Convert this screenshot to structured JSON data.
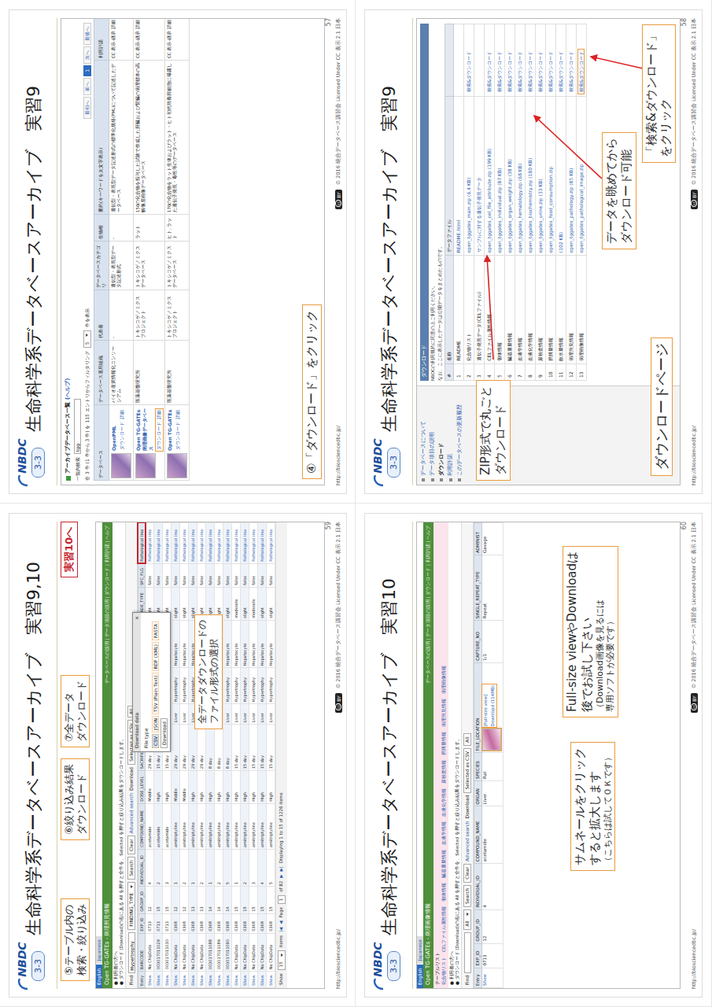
{
  "slides": [
    {
      "kind": "dblist",
      "logo": "NBDC",
      "badge": "3-3",
      "title": "生命科学系データベースアーカイブ　実習9",
      "page": "57",
      "url": "http://biosciencedbc.jp/",
      "cc": [
        "cc",
        "BY"
      ],
      "copyright": "© 2016  統合データベース講習会 Licensed Under CC 表示 2.1 日本",
      "screen": {
        "heading": "アーカイブデータベース一覧",
        "help": "(ヘルプ)",
        "search_label": "一覧内検索",
        "search_value": "tgg",
        "info": "全 3 件 (1 件から 3 件) を 115 エントリからフィルタリング",
        "per_page": "5",
        "per_page_label": "件を表示",
        "pager": [
          {
            "label": "最初へ",
            "selected": false
          },
          {
            "label": "前へ",
            "selected": false
          },
          {
            "label": "1",
            "selected": true
          },
          {
            "label": "次へ",
            "selected": false
          },
          {
            "label": "最後へ",
            "selected": false
          }
        ],
        "columns": [
          "データベース",
          "データベース運用組織",
          "代表者",
          "データベースカテゴリ",
          "生物種",
          "要約(キーワードを太文字表示)",
          "利用許諾"
        ],
        "rows": [
          {
            "name": "OpenPML",
            "links": [
              "ダウンロード",
              "詳細"
            ],
            "highlighted": false,
            "cells": [
              "バイオ産業情報化コンソーシアム",
              "-",
              "遺伝型・表現型データ記述形式",
              "-",
              "遺伝型・表現型データ記述形式の標準化規格(PML)について記述したデータベース",
              "CC 表示-継承 詳細"
            ]
          },
          {
            "name": "Open TG-GATEs 病理画像データベース",
            "links": [
              "ダウンロード",
              "詳細"
            ],
            "highlighted": true,
            "cells": [
              "医薬基盤研究所",
              "トキシコゲノミクスプロジェクト",
              "トキシコゲノミクスデータベース",
              "ラット",
              "150の化合物を投与した試験で作成した肝臓および腎臓の病理標本の高解像度画像データベース",
              "CC 表示-継承 詳細"
            ]
          },
          {
            "name": "Open TG-GATEs",
            "links": [
              "ダウンロード",
              "詳細"
            ],
            "highlighted": false,
            "cells": [
              "医薬基盤研究所",
              "トキシコゲノミクスプロジェクト",
              "トキシコゲノミクスデータベース",
              "ヒト, ラット",
              "170の化合物をラット生体およびラット・ヒト初代培養肝細胞に曝露した遺伝子発現・毒性等のデータベース",
              "CC 表示-継承 詳細"
            ]
          }
        ]
      },
      "callouts": [
        {
          "lines": [
            "④「ダウンロード」をクリック"
          ]
        }
      ]
    },
    {
      "kind": "download",
      "logo": "NBDC",
      "badge": "3-3",
      "title": "生命科学系データベースアーカイブ　実習9",
      "page": "58",
      "url": "http://biosciencedbc.jp/",
      "cc": [
        "cc",
        "BY"
      ],
      "copyright": "© 2016  統合データベース講習会 Licensed Under CC 表示 2.1 日本",
      "screen": {
        "sidebar": [
          {
            "label": "データベースについて",
            "selected": false
          },
          {
            "label": "データ項目の説明",
            "selected": false
          },
          {
            "label": "ダウンロード",
            "selected": true
          },
          {
            "label": "利用許諾",
            "selected": false
          },
          {
            "label": "このデータベースの更新履歴",
            "selected": false
          }
        ],
        "heading": "ダウンロード",
        "notes": [
          "NBDCの利用規約に同意の上ご利用ください。",
          "なお、ここに表示したデータは公開データをまとめたものです。"
        ],
        "columns": [
          "#",
          "名称",
          "データファイル",
          ""
        ],
        "rows": [
          {
            "no": "1",
            "name": "README",
            "file": "README.html",
            "action": "",
            "highlighted": false
          },
          {
            "no": "2",
            "name": "化合物リスト",
            "file": "open_tggates_main.zip (6.4 KB)",
            "action": "検索&ダウンロード",
            "highlighted": false
          },
          {
            "no": "3",
            "name": "遺伝子発現データ(CELファイル)",
            "file": "サンプルに対する遺伝子発現データ",
            "action": "",
            "highlighted": false
          },
          {
            "no": "4",
            "name": "CELファイル属性情報",
            "file": "open_tggates_cel_file_attribute.zip (199 KB)",
            "action": "検索&ダウンロード",
            "highlighted": false
          },
          {
            "no": "5",
            "name": "個体情報",
            "file": "open_tggates_individual.zip (87 KB)",
            "action": "検索&ダウンロード",
            "highlighted": false
          },
          {
            "no": "6",
            "name": "臓器重量情報",
            "file": "open_tggates_organ_weight.zip (38 KB)",
            "action": "検索&ダウンロード",
            "highlighted": false
          },
          {
            "no": "7",
            "name": "血液学情報",
            "file": "open_tggates_hematology.zip (68 KB)",
            "action": "検索&ダウンロード",
            "highlighted": false
          },
          {
            "no": "8",
            "name": "血液化学情報",
            "file": "open_tggates_biochemistry.zip (180 KB)",
            "action": "検索&ダウンロード",
            "highlighted": false
          },
          {
            "no": "9",
            "name": "尿検査情報",
            "file": "open_tggates_urine.zip (33 KB)",
            "action": "検索&ダウンロード",
            "highlighted": false
          },
          {
            "no": "10",
            "name": "摂餌量情報",
            "file": "open_tggates_food_consumption.zip",
            "action": "検索&ダウンロード",
            "highlighted": false
          },
          {
            "no": "11",
            "name": "飲水量情報",
            "file": "(102 KB)",
            "action": "検索&ダウンロード",
            "highlighted": false
          },
          {
            "no": "12",
            "name": "病理所見情報",
            "file": "open_tggates_pathology.zip (85 KB)",
            "action": "検索&ダウンロード",
            "highlighted": false
          },
          {
            "no": "13",
            "name": "病理画像情報",
            "file": "open_tggates_pathological_image.zip",
            "action": "検索&ダウンロード",
            "highlighted": true
          }
        ]
      },
      "callouts": [
        {
          "lines": [
            "ZIP形式で丸ごと",
            "ダウンロード"
          ]
        },
        {
          "lines": [
            "データを眺めてから",
            "ダウンロード可能"
          ]
        },
        {
          "lines": [
            "「検索&ダウンロード」",
            "をクリック"
          ]
        },
        {
          "lines": [
            "ダウンロードページ"
          ]
        }
      ]
    },
    {
      "kind": "table",
      "logo": "NBDC",
      "badge": "3-3",
      "title": "生命科学系データベースアーカイブ　実習9,10",
      "page": "59",
      "url": "http://biosciencedbc.jp/",
      "cc": [
        "cc",
        "BY"
      ],
      "copyright": "© 2016  統合データベース講習会 Licensed Under CC 表示 2.1 日本",
      "screen": {
        "lang": [
          {
            "label": "English",
            "selected": true
          },
          {
            "label": "Japanese",
            "selected": false
          }
        ],
        "brand": "Open TG-GATEs - 病理所見情報",
        "nav": "データベースの説明 | データ項目の説明 | ダウンロード | 利用許諾 | ヘルプ",
        "notes": [
          "● 利用者の方へ",
          "● ダウンロード (Download)の右にある All を押すと全件を、Selected を押すと絞り込み結果をダウンロードします。"
        ],
        "toolbar": {
          "find": "Find",
          "value": "Hypertrophy",
          "field": "FINDING_TYPE",
          "buttons": [
            "Search",
            "Clear"
          ],
          "advanced": "Advanced search",
          "download": "Download",
          "selected_as": "Selected as CSV",
          "all": "All"
        },
        "columns": [
          {
            "label": "Entry",
            "highlighted": false
          },
          {
            "label": "BARCODE",
            "highlighted": false
          },
          {
            "label": "EXP_ID",
            "highlighted": false
          },
          {
            "label": "GROUP_ID",
            "highlighted": false
          },
          {
            "label": "INDIVIDUAL_ID",
            "highlighted": false
          },
          {
            "label": "COMPOUND_NAME",
            "highlighted": false
          },
          {
            "label": "DOSE_LEVEL",
            "highlighted": false
          },
          {
            "label": "SACRIFICE_PERIOD",
            "highlighted": false
          },
          {
            "label": "ORGAN",
            "highlighted": false
          },
          {
            "label": "FINDING_TYPE",
            "highlighted": false
          },
          {
            "label": "TOPOGRAPHY_TYPE",
            "highlighted": false
          },
          {
            "label": "GRADE_TYPE",
            "highlighted": false
          },
          {
            "label": "SPC_FLG",
            "highlighted": false
          },
          {
            "label": "Pathological ima",
            "highlighted": true
          }
        ],
        "rows": [
          [
            "Show",
            "No ChipData",
            "0713",
            "12",
            "4",
            "acetamide",
            "Middle",
            "29 day",
            "Liver",
            "Hypertrophy",
            "Hepatocyte",
            "slight",
            "false",
            "Pathological ima"
          ],
          [
            "Show",
            "003017011029",
            "0713",
            "15",
            "2",
            "acetamide",
            "High",
            "15 day",
            "Liver",
            "Hypertrophy",
            "Hepatocyte",
            "slight",
            "false",
            "Pathological ima"
          ],
          [
            "Show",
            "003017011030",
            "0713",
            "15",
            "3",
            "acetamide",
            "High",
            "15 day",
            "Liver",
            "Hypertrophy",
            "Hepatocyte",
            "slight",
            "false",
            "Pathological ima"
          ],
          [
            "Show",
            "No ChipData",
            "0368",
            "12",
            "1",
            "amitriptyline",
            "Middle",
            "29 day",
            "Liver",
            "Hypertrophy",
            "Hepatocyte",
            "slight",
            "false",
            "Pathological ima"
          ],
          [
            "Show",
            "No ChipData",
            "0368",
            "12",
            "2",
            "amitriptyline",
            "Middle",
            "29 day",
            "Liver",
            "Hypertrophy",
            "Hepatocyte",
            "slight",
            "false",
            "Pathological ima"
          ],
          [
            "Show",
            "No ChipData",
            "0368",
            "13",
            "1",
            "amitriptyline",
            "High",
            "29 day",
            "Liver",
            "Hypertrophy",
            "Hepatocyte",
            "slight",
            "false",
            "Pathological ima"
          ],
          [
            "Show",
            "No ChipData",
            "0368",
            "13",
            "2",
            "amitriptyline",
            "High",
            "29 day",
            "Liver",
            "Hypertrophy",
            "Hepatocyte",
            "slight",
            "false",
            "Pathological ima"
          ],
          [
            "Show",
            "003017011088",
            "0368",
            "14",
            "1",
            "amitriptyline",
            "High",
            "8 day",
            "Liver",
            "Hypertrophy",
            "Hepatocyte",
            "slight",
            "false",
            "Pathological ima"
          ],
          [
            "Show",
            "003017011089",
            "0368",
            "14",
            "2",
            "amitriptyline",
            "High",
            "8 day",
            "Liver",
            "Hypertrophy",
            "Hepatocyte",
            "slight",
            "false",
            "Pathological ima"
          ],
          [
            "Show",
            "003017011090",
            "0368",
            "14",
            "5",
            "amitriptyline",
            "High",
            "8 day",
            "Liver",
            "Hypertrophy",
            "Hepatocyte",
            "slight",
            "false",
            "Pathological ima"
          ],
          [
            "Show",
            "No ChipData",
            "0368",
            "15",
            "1",
            "amitriptyline",
            "High",
            "15 day",
            "Liver",
            "Hypertrophy",
            "Hepatocyte",
            "moderate",
            "false",
            "Pathological ima"
          ],
          [
            "Show",
            "No ChipData",
            "0368",
            "15",
            "2",
            "amitriptyline",
            "High",
            "15 day",
            "Liver",
            "Hypertrophy",
            "Hepatocyte",
            "slight",
            "false",
            "Pathological ima"
          ],
          [
            "Show",
            "No ChipData",
            "0368",
            "15",
            "3",
            "amitriptyline",
            "High",
            "15 day",
            "Liver",
            "Hypertrophy",
            "Hepatocyte",
            "moderate",
            "false",
            "Pathological ima"
          ],
          [
            "Show",
            "No ChipData",
            "0368",
            "15",
            "4",
            "amitriptyline",
            "High",
            "15 day",
            "Liver",
            "Hypertrophy",
            "Hepatocyte",
            "slight",
            "false",
            "Pathological ima"
          ],
          [
            "Show",
            "No ChipData",
            "0368",
            "15",
            "5",
            "amitriptyline",
            "High",
            "15 day",
            "Liver",
            "Hypertrophy",
            "Hepatocyte",
            "slight",
            "false",
            "Pathological ima"
          ]
        ],
        "pager": {
          "show": "Show",
          "per_page": "15",
          "items": "items",
          "first": "|◀",
          "prev": "◀",
          "page_label": "Page",
          "page": "1",
          "of": "of 82",
          "next": "▶",
          "last": "▶|",
          "display": "Displaying 1 to 15 of 1226 items"
        },
        "popup": {
          "title": "Download data",
          "close": "×",
          "label": "File type",
          "options": [
            {
              "label": "CSV",
              "selected": true
            },
            {
              "label": "JSON",
              "selected": false
            },
            {
              "label": "TSV (Plain Text)",
              "selected": false
            },
            {
              "label": "RDF (XML)",
              "selected": false
            },
            {
              "label": "FASTA",
              "selected": false
            }
          ],
          "button": "Download"
        }
      },
      "callouts": [
        {
          "lines": [
            "⑤テーブル内の",
            "検索・絞り込み"
          ]
        },
        {
          "lines": [
            "⑥絞り込み結果",
            "ダウンロード"
          ]
        },
        {
          "lines": [
            "⑦全データ",
            "ダウンロード"
          ]
        },
        {
          "lines": [
            "全データダウンロードの",
            "ファイル形式の選択"
          ]
        },
        {
          "lines": [
            "実習10へ"
          ]
        }
      ]
    },
    {
      "kind": "images",
      "logo": "NBDC",
      "badge": "3-3",
      "title": "生命科学系データベースアーカイブ　実習10",
      "page": "60",
      "url": "http://biosciencedbc.jp/",
      "cc": [
        "cc",
        "BY"
      ],
      "copyright": "© 2016  統合データベース講習会 Licensed Under CC 表示 2.1 日本",
      "screen": {
        "lang": [
          {
            "label": "English",
            "selected": true
          },
          {
            "label": "Japanese",
            "selected": false
          }
        ],
        "brand": "Open TG-GATEs - 病理画像情報",
        "nav": "データベースの説明 | データ項目の説明 | ダウンロード | 利用許諾 | ヘルプ",
        "list_title": "テーブルリスト",
        "tables": [
          "化合物リスト",
          "CELファイル属性情報",
          "個体情報",
          "臓器重量情報",
          "血液学情報",
          "血液化学情報",
          "尿検査情報",
          "摂餌量情報",
          "病理所見情報",
          "病理画像情報"
        ],
        "notes": [
          "● 利用者の方へ",
          "● ダウンロード (Download)の右にある All を押すと全件を、Selected を押すと絞り込み結果をダウンロードします。"
        ],
        "toolbar": {
          "find": "Find",
          "value": "",
          "field": "All",
          "buttons": [
            "Search",
            "Clear"
          ],
          "advanced": "Advanced search",
          "download": "Download",
          "selected_as": "Selected as CSV",
          "all": "All"
        },
        "columns": [
          "Entry",
          "EXP_ID",
          "GROUP_ID",
          "INDIVIDUAL_ID",
          "COMPOUND_NAME",
          "ORGAN",
          "SPECIES",
          "FILE_LOCATION",
          "CAPTURE_NO",
          "SINGLE_REPEAT_TYPE",
          "ADMINIST"
        ],
        "row": {
          "cells": [
            "Show",
            "0713",
            "12",
            "4",
            "acetamide",
            "Liver",
            "Rat"
          ],
          "links": [
            "[Full-size view]",
            "Download (114MB)"
          ],
          "after": [
            "1/1",
            "Repeat",
            "Gavage"
          ]
        }
      },
      "callouts": [
        {
          "lines": [
            "サムネールをクリック",
            "すると拡大します"
          ],
          "notes": [
            "（こちらは試してＯＫです）"
          ]
        },
        {
          "lines": [
            "Full-size viewやDownloadは",
            "後でお試し下さい"
          ],
          "notes": [
            "（Download画像を見るには",
            "専用ソフトが必要です）"
          ]
        }
      ]
    }
  ]
}
